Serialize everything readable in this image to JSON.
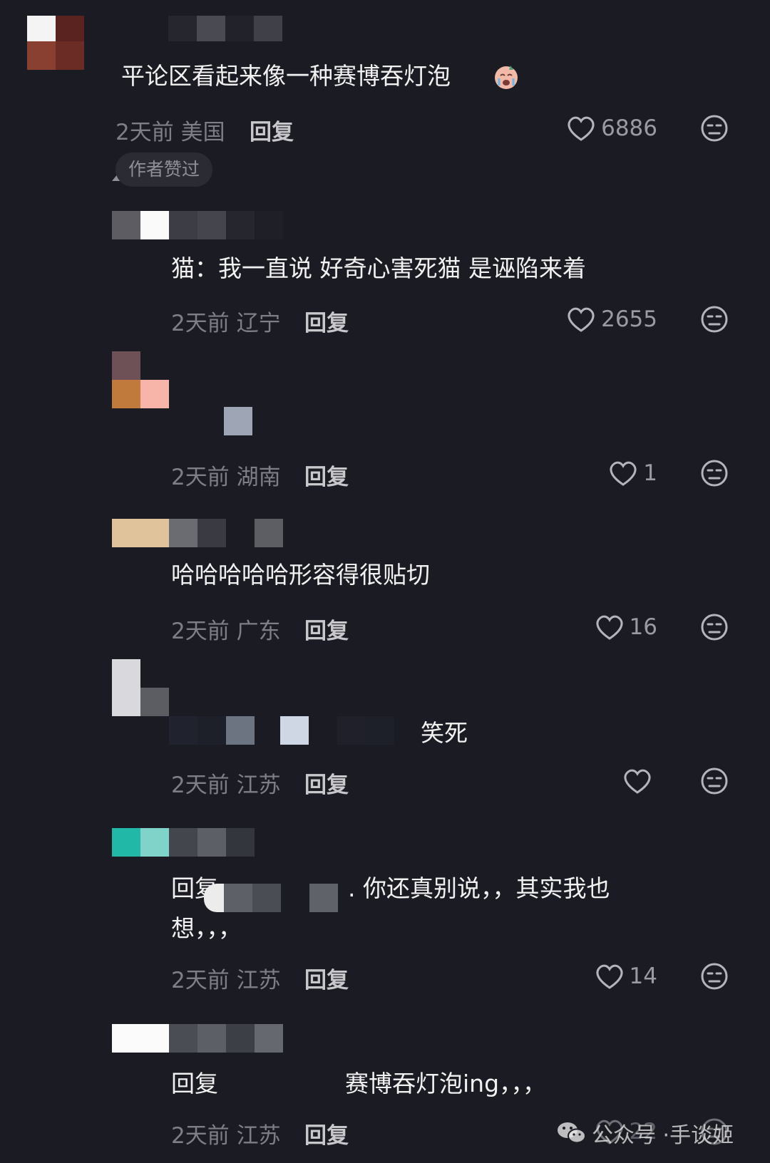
{
  "comments": [
    {
      "text": "平论区看起来像一种赛博吞灯泡",
      "time": "2天前 美国",
      "reply": "回复",
      "likes": "6886",
      "badge": "作者赞过"
    },
    {
      "text": "猫：我一直说 好奇心害死猫 是诬陷来着",
      "time": "2天前 辽宁",
      "reply": "回复",
      "likes": "2655"
    },
    {
      "text": "",
      "time": "2天前 湖南",
      "reply": "回复",
      "likes": "1"
    },
    {
      "text": "哈哈哈哈哈形容得很贴切",
      "time": "2天前 广东",
      "reply": "回复",
      "likes": "16"
    },
    {
      "text": "笑死",
      "time": "2天前 江苏",
      "reply": "回复",
      "likes": ""
    },
    {
      "text_a": "回复",
      "text_b": ". 你还真别说，，其实我也",
      "text_c": "想，，，",
      "time": "2天前 江苏",
      "reply": "回复",
      "likes": "14"
    },
    {
      "text_a": "回复",
      "text_b": "赛博吞灯泡ing，，，",
      "time": "2天前 江苏",
      "reply": "回复",
      "likes": "22"
    }
  ],
  "watermark": {
    "prefix": "公众号 · ",
    "name": "手谈姬"
  },
  "icons": {
    "like": "heart-outline-icon",
    "dislike": "neutral-face-icon",
    "wechat": "wechat-icon"
  }
}
